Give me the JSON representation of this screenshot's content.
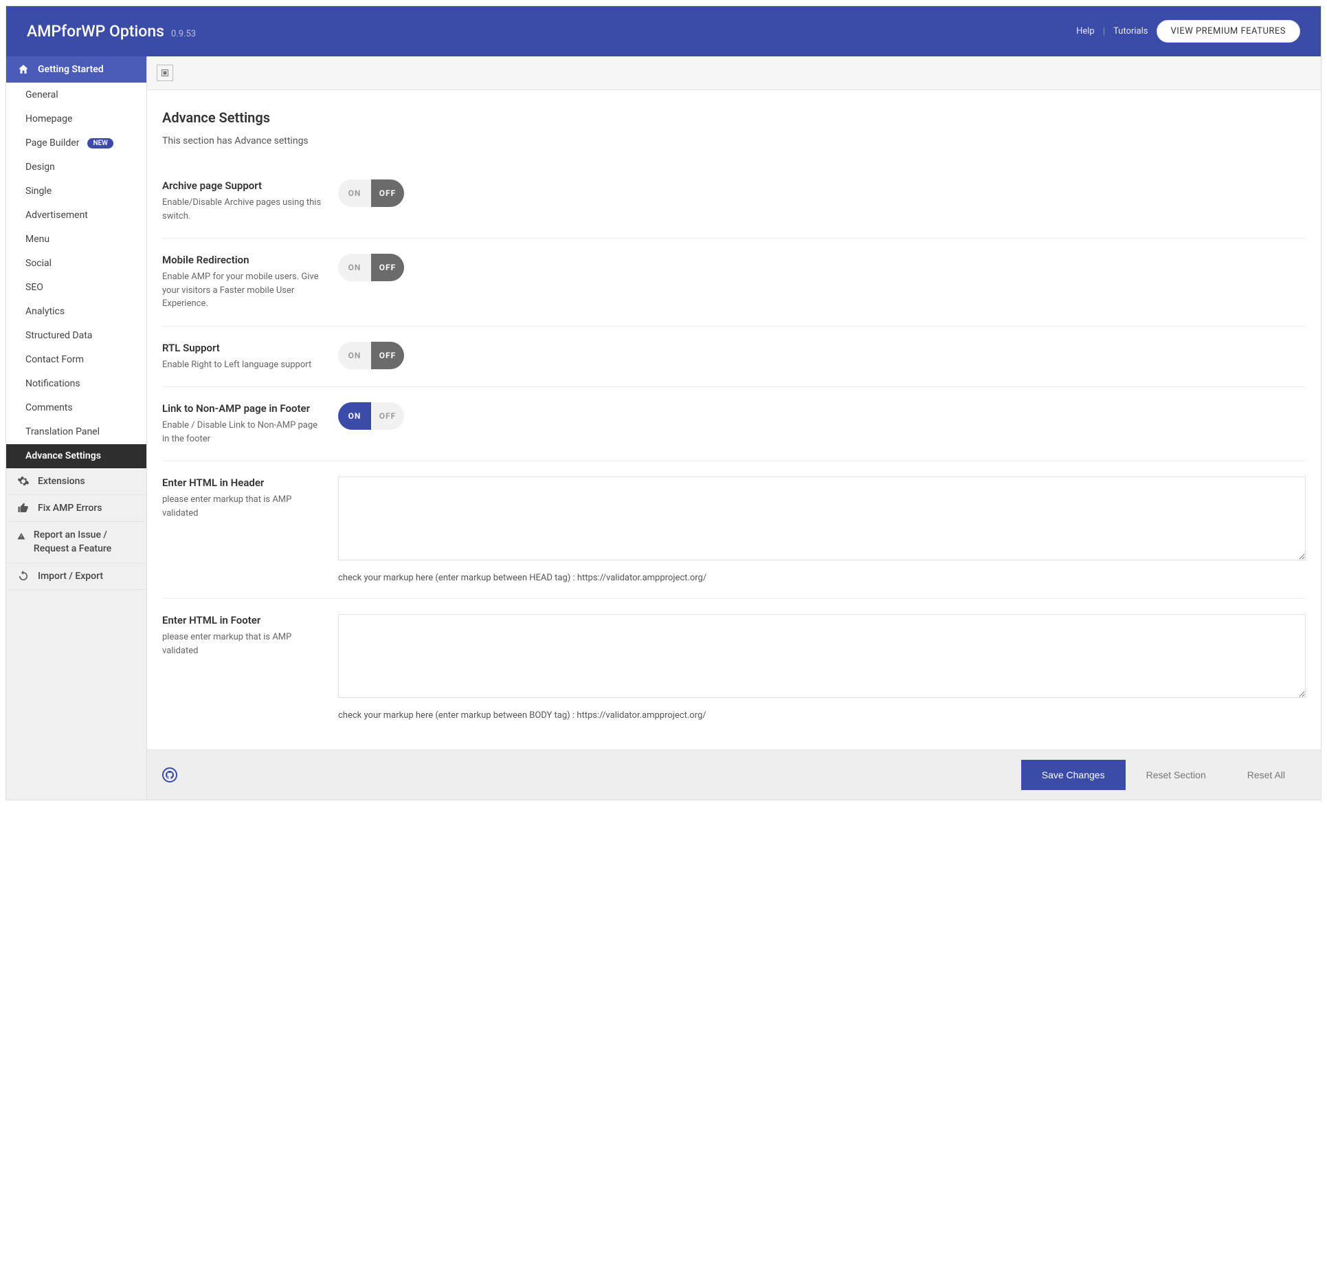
{
  "header": {
    "title": "AMPforWP Options",
    "version": "0.9.53",
    "help": "Help",
    "tutorials": "Tutorials",
    "premium": "VIEW PREMIUM FEATURES"
  },
  "sidebar": {
    "getting_started": "Getting Started",
    "items": [
      "General",
      "Homepage",
      "Page Builder",
      "Design",
      "Single",
      "Advertisement",
      "Menu",
      "Social",
      "SEO",
      "Analytics",
      "Structured Data",
      "Contact Form",
      "Notifications",
      "Comments",
      "Translation Panel",
      "Advance Settings"
    ],
    "new_badge": "NEW",
    "extensions": "Extensions",
    "fix_errors": "Fix AMP Errors",
    "report_issue": "Report an Issue / Request a Feature",
    "import_export": "Import / Export"
  },
  "main": {
    "title": "Advance Settings",
    "subtitle": "This section has Advance settings",
    "on": "ON",
    "off": "OFF",
    "fields": {
      "archive": {
        "title": "Archive page Support",
        "desc": "Enable/Disable Archive pages using this switch."
      },
      "mobile": {
        "title": "Mobile Redirection",
        "desc": "Enable AMP for your mobile users. Give your visitors a Faster mobile User Experience."
      },
      "rtl": {
        "title": "RTL Support",
        "desc": "Enable Right to Left language support"
      },
      "nonamp": {
        "title": "Link to Non-AMP page in Footer",
        "desc": "Enable / Disable Link to Non-AMP page in the footer"
      },
      "html_header": {
        "title": "Enter HTML in Header",
        "desc": "please enter markup that is AMP validated",
        "hint": "check your markup here (enter markup between HEAD tag) : https://validator.ampproject.org/"
      },
      "html_footer": {
        "title": "Enter HTML in Footer",
        "desc": "please enter markup that is AMP validated",
        "hint": "check your markup here (enter markup between BODY tag) : https://validator.ampproject.org/"
      }
    }
  },
  "footer": {
    "save": "Save Changes",
    "reset_section": "Reset Section",
    "reset_all": "Reset All"
  }
}
